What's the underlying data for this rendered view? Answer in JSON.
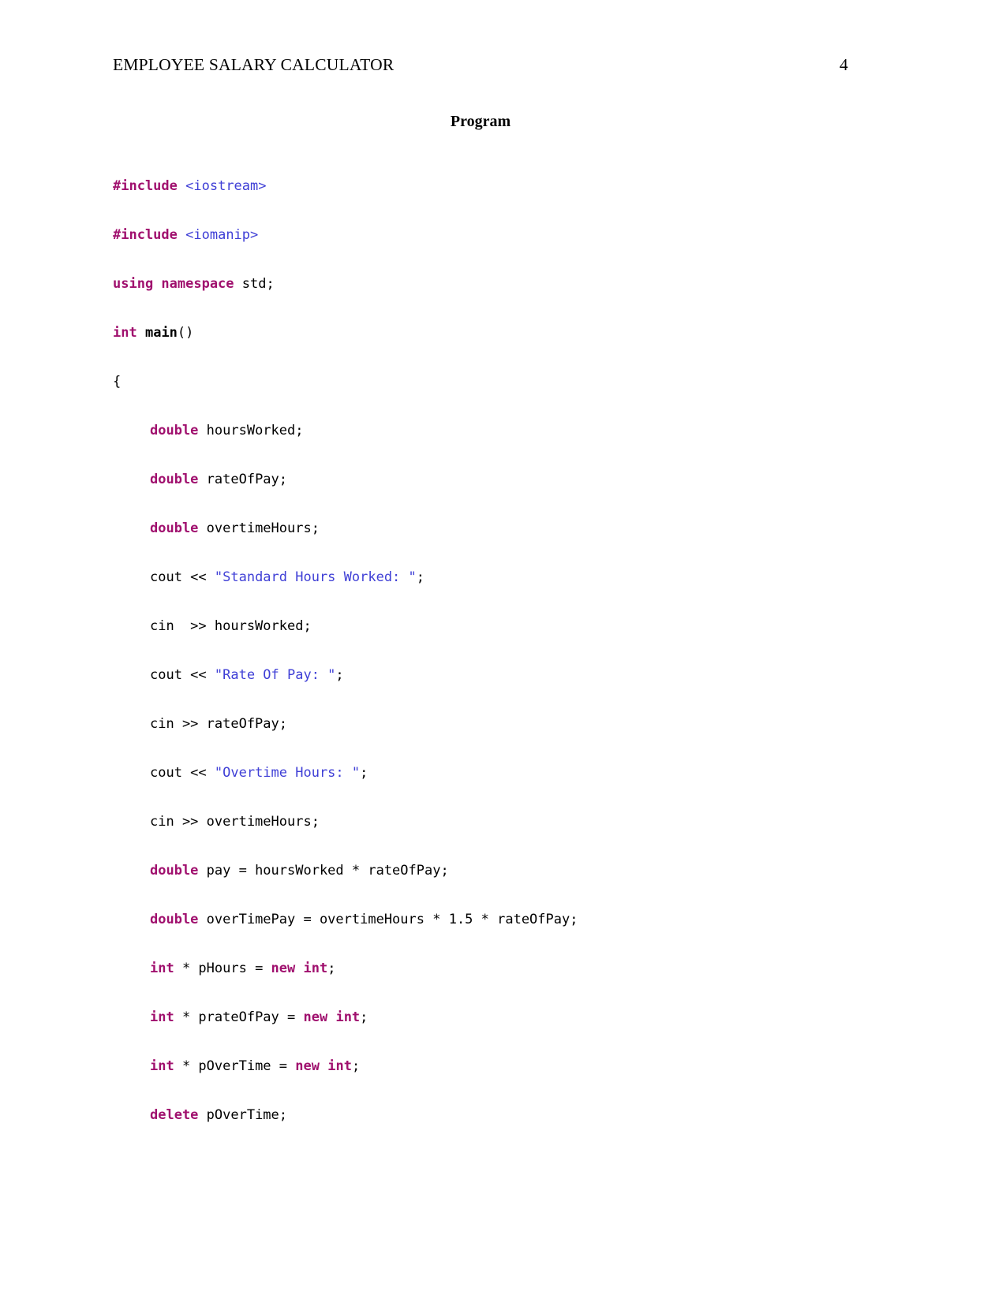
{
  "document": {
    "header": {
      "title": "EMPLOYEE SALARY CALCULATOR",
      "page_number": "4"
    },
    "section_title": "Program",
    "colors": {
      "keyword": "#a0106e",
      "string": "#3f3fd6",
      "include_path": "#3f3fd6",
      "plain_text": "#000000",
      "page_background": "#ffffff"
    },
    "code": {
      "language": "C++",
      "lines": [
        {
          "indent": 0,
          "tokens": [
            {
              "text": "#include",
              "style": "keyword"
            },
            {
              "text": " ",
              "style": "plain"
            },
            {
              "text": "<iostream>",
              "style": "include_path"
            }
          ]
        },
        {
          "indent": 0,
          "tokens": [
            {
              "text": "#include",
              "style": "keyword"
            },
            {
              "text": " ",
              "style": "plain"
            },
            {
              "text": "<iomanip>",
              "style": "include_path"
            }
          ]
        },
        {
          "indent": 0,
          "tokens": [
            {
              "text": "using namespace",
              "style": "keyword"
            },
            {
              "text": " std;",
              "style": "plain"
            }
          ]
        },
        {
          "indent": 0,
          "tokens": [
            {
              "text": "int",
              "style": "keyword"
            },
            {
              "text": " ",
              "style": "plain"
            },
            {
              "text": "main",
              "style": "function"
            },
            {
              "text": "()",
              "style": "plain"
            }
          ]
        },
        {
          "indent": 0,
          "tokens": [
            {
              "text": "{",
              "style": "plain"
            }
          ]
        },
        {
          "indent": 1,
          "tokens": [
            {
              "text": "double",
              "style": "keyword"
            },
            {
              "text": " hoursWorked;",
              "style": "plain"
            }
          ]
        },
        {
          "indent": 1,
          "tokens": [
            {
              "text": "double",
              "style": "keyword"
            },
            {
              "text": " rateOfPay;",
              "style": "plain"
            }
          ]
        },
        {
          "indent": 1,
          "tokens": [
            {
              "text": "double",
              "style": "keyword"
            },
            {
              "text": " overtimeHours;",
              "style": "plain"
            }
          ]
        },
        {
          "indent": 1,
          "tokens": [
            {
              "text": "cout << ",
              "style": "plain"
            },
            {
              "text": "\"Standard Hours Worked: \"",
              "style": "string"
            },
            {
              "text": ";",
              "style": "plain"
            }
          ]
        },
        {
          "indent": 1,
          "tokens": [
            {
              "text": "cin  >> hoursWorked;",
              "style": "plain"
            }
          ]
        },
        {
          "indent": 1,
          "tokens": [
            {
              "text": "cout << ",
              "style": "plain"
            },
            {
              "text": "\"Rate Of Pay: \"",
              "style": "string"
            },
            {
              "text": ";",
              "style": "plain"
            }
          ]
        },
        {
          "indent": 1,
          "tokens": [
            {
              "text": "cin >> rateOfPay;",
              "style": "plain"
            }
          ]
        },
        {
          "indent": 1,
          "tokens": [
            {
              "text": "cout << ",
              "style": "plain"
            },
            {
              "text": "\"Overtime Hours: \"",
              "style": "string"
            },
            {
              "text": ";",
              "style": "plain"
            }
          ]
        },
        {
          "indent": 1,
          "tokens": [
            {
              "text": "cin >> overtimeHours;",
              "style": "plain"
            }
          ]
        },
        {
          "indent": 1,
          "tokens": [
            {
              "text": "double",
              "style": "keyword"
            },
            {
              "text": " pay = hoursWorked * rateOfPay;",
              "style": "plain"
            }
          ]
        },
        {
          "indent": 1,
          "tokens": [
            {
              "text": "double",
              "style": "keyword"
            },
            {
              "text": " overTimePay = overtimeHours * 1.5 * rateOfPay;",
              "style": "plain"
            }
          ]
        },
        {
          "indent": 1,
          "tokens": [
            {
              "text": "int",
              "style": "keyword"
            },
            {
              "text": " * pHours = ",
              "style": "plain"
            },
            {
              "text": "new",
              "style": "keyword"
            },
            {
              "text": " ",
              "style": "plain"
            },
            {
              "text": "int",
              "style": "keyword"
            },
            {
              "text": ";",
              "style": "plain"
            }
          ]
        },
        {
          "indent": 1,
          "tokens": [
            {
              "text": "int",
              "style": "keyword"
            },
            {
              "text": " * prateOfPay = ",
              "style": "plain"
            },
            {
              "text": "new",
              "style": "keyword"
            },
            {
              "text": " ",
              "style": "plain"
            },
            {
              "text": "int",
              "style": "keyword"
            },
            {
              "text": ";",
              "style": "plain"
            }
          ]
        },
        {
          "indent": 1,
          "tokens": [
            {
              "text": "int",
              "style": "keyword"
            },
            {
              "text": " * pOverTime = ",
              "style": "plain"
            },
            {
              "text": "new",
              "style": "keyword"
            },
            {
              "text": " ",
              "style": "plain"
            },
            {
              "text": "int",
              "style": "keyword"
            },
            {
              "text": ";",
              "style": "plain"
            }
          ]
        },
        {
          "indent": 1,
          "tokens": [
            {
              "text": "delete",
              "style": "keyword"
            },
            {
              "text": " pOverTime;",
              "style": "plain"
            }
          ]
        }
      ]
    }
  }
}
